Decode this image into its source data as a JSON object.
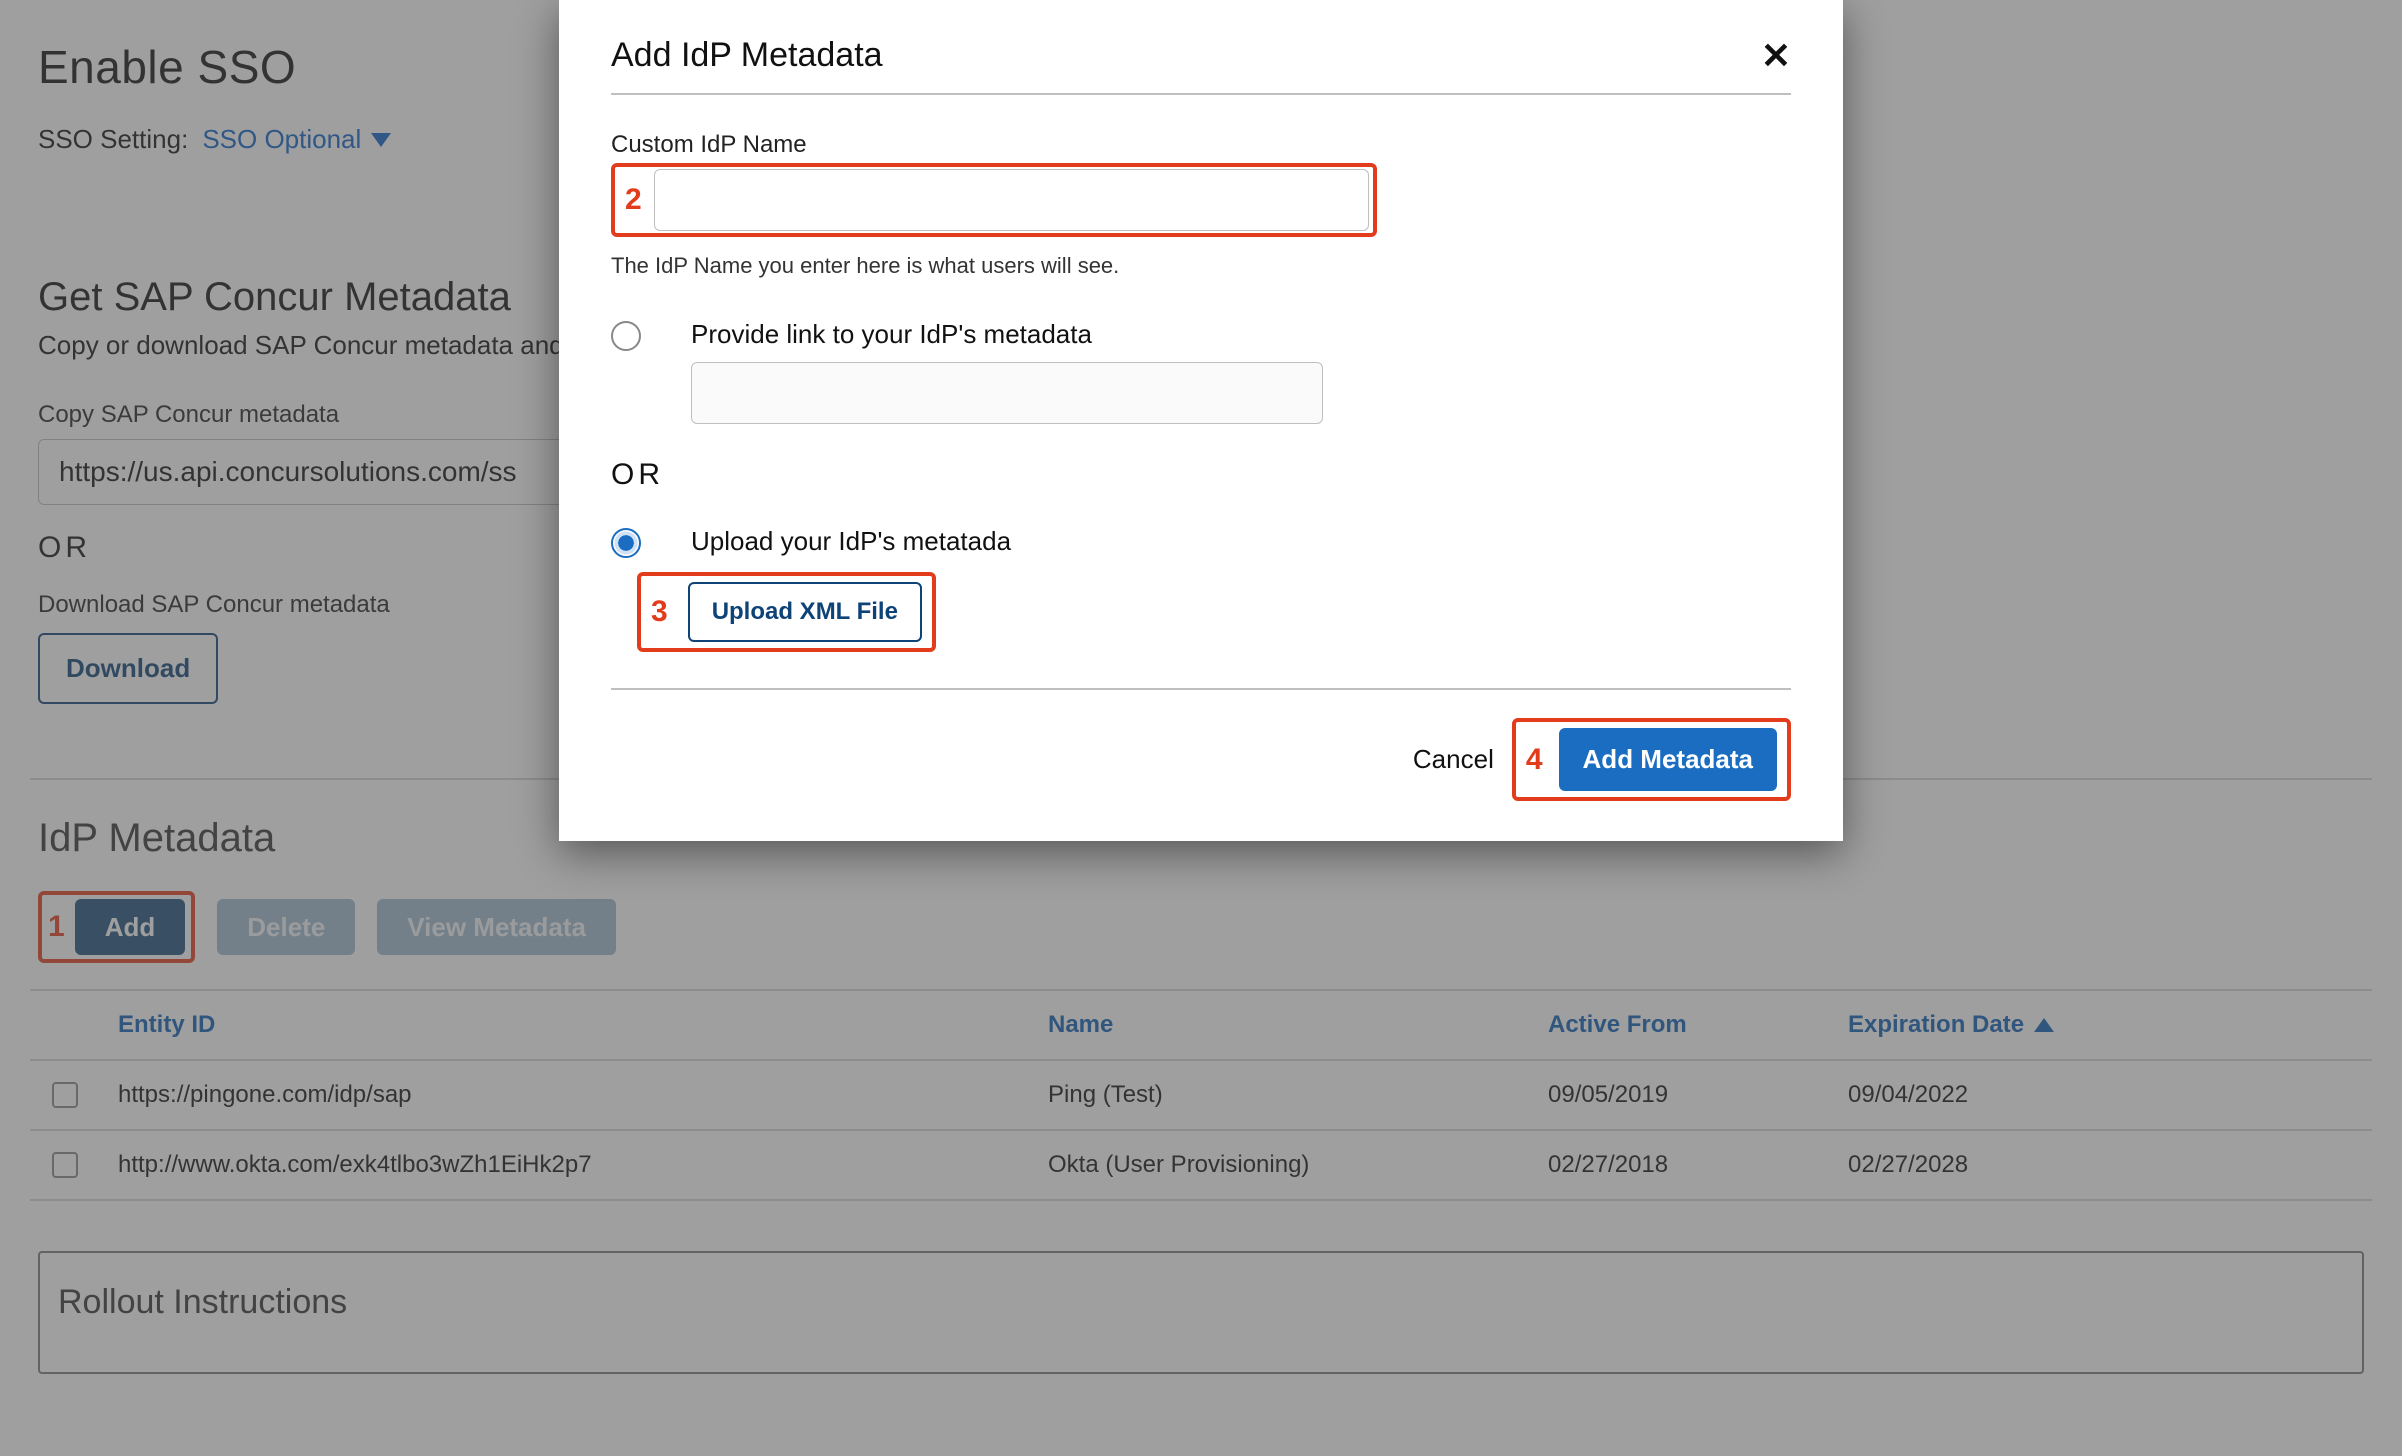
{
  "annotations": {
    "n1": "1",
    "n2": "2",
    "n3": "3",
    "n4": "4"
  },
  "page": {
    "enable_sso_title": "Enable SSO",
    "sso_setting_label": "SSO Setting:",
    "sso_option": "SSO Optional",
    "get_metadata_title": "Get SAP Concur Metadata",
    "get_metadata_desc": "Copy or download SAP Concur metadata and ad",
    "copy_metadata_label": "Copy SAP Concur metadata",
    "metadata_url": "https://us.api.concursolutions.com/ss",
    "or": "OR",
    "download_label": "Download SAP Concur metadata",
    "download_btn": "Download",
    "idp_metadata_title": "IdP Metadata",
    "buttons": {
      "add": "Add",
      "delete": "Delete",
      "view": "View Metadata"
    },
    "columns": {
      "entity": "Entity ID",
      "name": "Name",
      "active": "Active From",
      "exp": "Expiration Date"
    },
    "rows": [
      {
        "entity": "https://pingone.com/idp/sap",
        "name": "Ping (Test)",
        "active": "09/05/2019",
        "exp": "09/04/2022"
      },
      {
        "entity": "http://www.okta.com/exk4tlbo3wZh1EiHk2p7",
        "name": "Okta (User Provisioning)",
        "active": "02/27/2018",
        "exp": "02/27/2028"
      }
    ],
    "rollout_title": "Rollout Instructions"
  },
  "modal": {
    "title": "Add IdP Metadata",
    "custom_idp_label": "Custom IdP Name",
    "idp_hint": "The IdP Name you enter here is what users will see.",
    "provide_link_label": "Provide link to your IdP's metadata",
    "or": "OR",
    "upload_label": "Upload your IdP's metatada",
    "upload_btn": "Upload XML File",
    "cancel": "Cancel",
    "add_btn": "Add Metadata"
  }
}
